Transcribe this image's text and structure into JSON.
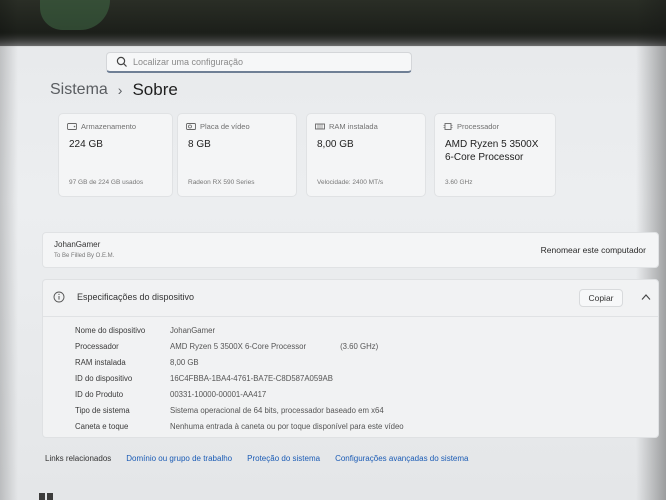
{
  "search": {
    "placeholder": "Localizar uma configuração"
  },
  "breadcrumb": {
    "parent": "Sistema",
    "separator": "›",
    "current": "Sobre"
  },
  "cards": [
    {
      "label": "Armazenamento",
      "value": "224 GB",
      "sub": "97 GB de 224 GB usados",
      "icon": "storage-icon"
    },
    {
      "label": "Placa de vídeo",
      "value": "8 GB",
      "sub": "Radeon RX 590 Series",
      "icon": "gpu-icon"
    },
    {
      "label": "RAM instalada",
      "value": "8,00 GB",
      "sub": "Velocidade: 2400 MT/s",
      "icon": "ram-icon"
    },
    {
      "label": "Processador",
      "value": "AMD Ryzen 5 3500X 6-Core Processor",
      "sub": "3.60 GHz",
      "icon": "cpu-icon"
    }
  ],
  "pc": {
    "name": "JohanGamer",
    "model": "To Be Filled By O.E.M.",
    "rename_label": "Renomear este computador"
  },
  "specs": {
    "title": "Especificações do dispositivo",
    "copy_label": "Copiar",
    "rows": [
      {
        "key": "Nome do dispositivo",
        "value": "JohanGamer",
        "extra": ""
      },
      {
        "key": "Processador",
        "value": "AMD Ryzen 5 3500X 6-Core Processor",
        "extra": "(3.60 GHz)"
      },
      {
        "key": "RAM instalada",
        "value": "8,00 GB",
        "extra": ""
      },
      {
        "key": "ID do dispositivo",
        "value": "16C4FBBA-1BA4-4761-BA7E-C8D587A059AB",
        "extra": ""
      },
      {
        "key": "ID do Produto",
        "value": "00331-10000-00001-AA417",
        "extra": ""
      },
      {
        "key": "Tipo de sistema",
        "value": "Sistema operacional de 64 bits, processador baseado em x64",
        "extra": ""
      },
      {
        "key": "Caneta e toque",
        "value": "Nenhuma entrada à caneta ou por toque disponível para este vídeo",
        "extra": ""
      }
    ]
  },
  "links": {
    "label": "Links relacionados",
    "items": [
      "Domínio ou grupo de trabalho",
      "Proteção do sistema",
      "Configurações avançadas do sistema"
    ]
  },
  "colors": {
    "accent": "#1a5bb5",
    "background": "#eceef0",
    "card": "#f4f5f6"
  }
}
